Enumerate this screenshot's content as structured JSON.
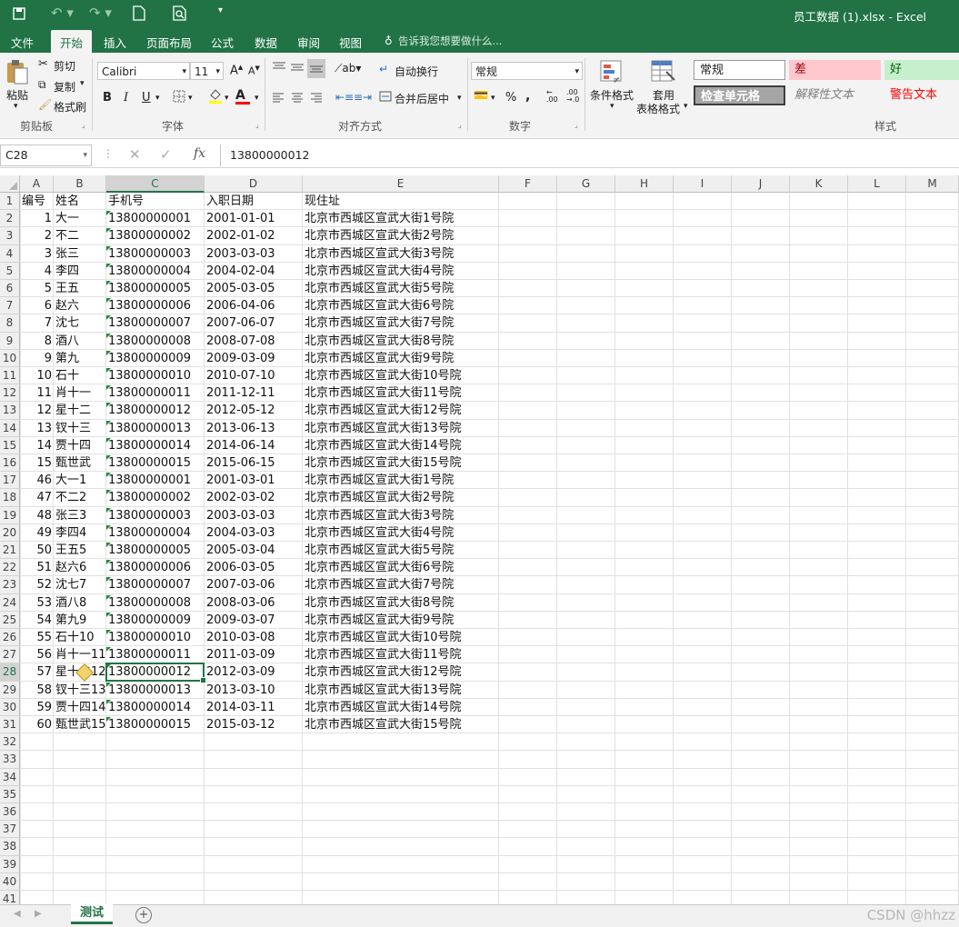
{
  "window": {
    "title": "员工数据 (1).xlsx - Excel"
  },
  "menu": {
    "items": [
      "文件",
      "开始",
      "插入",
      "页面布局",
      "公式",
      "数据",
      "审阅",
      "视图"
    ],
    "tell_me": "告诉我您想要做什么..."
  },
  "ribbon": {
    "clipboard": {
      "paste": "粘贴",
      "cut": "剪切",
      "copy": "复制",
      "format_painter": "格式刷",
      "group": "剪贴板"
    },
    "font": {
      "name": "Calibri",
      "size": "11",
      "bold": "B",
      "italic": "I",
      "underline": "U",
      "font_color_letter": "A",
      "group": "字体"
    },
    "alignment": {
      "wrap": "自动换行",
      "merge": "合并后居中",
      "group": "对齐方式"
    },
    "number": {
      "format": "常规",
      "percent": "%",
      "comma": ",",
      "group": "数字"
    },
    "styles": {
      "conditional": "条件格式",
      "table_format_1": "套用",
      "table_format_2": "表格格式",
      "normal": "常规",
      "bad": "差",
      "good": "好",
      "check_cell": "检查单元格",
      "explanatory": "解释性文本",
      "warning": "警告文本",
      "group": "样式"
    }
  },
  "formula_bar": {
    "name_box": "C28",
    "value": "13800000012"
  },
  "columns": [
    "A",
    "B",
    "C",
    "D",
    "E",
    "F",
    "G",
    "H",
    "I",
    "J",
    "K",
    "L",
    "M"
  ],
  "selected_cell": {
    "column": "C",
    "row": 28
  },
  "header_row": [
    "编号",
    "姓名",
    "手机号",
    "入职日期",
    "现住址"
  ],
  "rows": [
    [
      "1",
      "大一",
      "13800000001",
      "2001-01-01",
      "北京市西城区宣武大街1号院"
    ],
    [
      "2",
      "不二",
      "13800000002",
      "2002-01-02",
      "北京市西城区宣武大街2号院"
    ],
    [
      "3",
      "张三",
      "13800000003",
      "2003-03-03",
      "北京市西城区宣武大街3号院"
    ],
    [
      "4",
      "李四",
      "13800000004",
      "2004-02-04",
      "北京市西城区宣武大街4号院"
    ],
    [
      "5",
      "王五",
      "13800000005",
      "2005-03-05",
      "北京市西城区宣武大街5号院"
    ],
    [
      "6",
      "赵六",
      "13800000006",
      "2006-04-06",
      "北京市西城区宣武大街6号院"
    ],
    [
      "7",
      "沈七",
      "13800000007",
      "2007-06-07",
      "北京市西城区宣武大街7号院"
    ],
    [
      "8",
      "酒八",
      "13800000008",
      "2008-07-08",
      "北京市西城区宣武大街8号院"
    ],
    [
      "9",
      "第九",
      "13800000009",
      "2009-03-09",
      "北京市西城区宣武大街9号院"
    ],
    [
      "10",
      "石十",
      "13800000010",
      "2010-07-10",
      "北京市西城区宣武大街10号院"
    ],
    [
      "11",
      "肖十一",
      "13800000011",
      "2011-12-11",
      "北京市西城区宣武大街11号院"
    ],
    [
      "12",
      "星十二",
      "13800000012",
      "2012-05-12",
      "北京市西城区宣武大街12号院"
    ],
    [
      "13",
      "钗十三",
      "13800000013",
      "2013-06-13",
      "北京市西城区宣武大街13号院"
    ],
    [
      "14",
      "贾十四",
      "13800000014",
      "2014-06-14",
      "北京市西城区宣武大街14号院"
    ],
    [
      "15",
      "甄世武",
      "13800000015",
      "2015-06-15",
      "北京市西城区宣武大街15号院"
    ],
    [
      "46",
      "大一1",
      "13800000001",
      "2001-03-01",
      "北京市西城区宣武大街1号院"
    ],
    [
      "47",
      "不二2",
      "13800000002",
      "2002-03-02",
      "北京市西城区宣武大街2号院"
    ],
    [
      "48",
      "张三3",
      "13800000003",
      "2003-03-03",
      "北京市西城区宣武大街3号院"
    ],
    [
      "49",
      "李四4",
      "13800000004",
      "2004-03-03",
      "北京市西城区宣武大街4号院"
    ],
    [
      "50",
      "王五5",
      "13800000005",
      "2005-03-04",
      "北京市西城区宣武大街5号院"
    ],
    [
      "51",
      "赵六6",
      "13800000006",
      "2006-03-05",
      "北京市西城区宣武大街6号院"
    ],
    [
      "52",
      "沈七7",
      "13800000007",
      "2007-03-06",
      "北京市西城区宣武大街7号院"
    ],
    [
      "53",
      "酒八8",
      "13800000008",
      "2008-03-06",
      "北京市西城区宣武大街8号院"
    ],
    [
      "54",
      "第九9",
      "13800000009",
      "2009-03-07",
      "北京市西城区宣武大街9号院"
    ],
    [
      "55",
      "石十10",
      "13800000010",
      "2010-03-08",
      "北京市西城区宣武大街10号院"
    ],
    [
      "56",
      "肖十一11",
      "13800000011",
      "2011-03-09",
      "北京市西城区宣武大街11号院"
    ],
    [
      "57",
      "星十二12",
      "13800000012",
      "2012-03-09",
      "北京市西城区宣武大街12号院"
    ],
    [
      "58",
      "钗十三13",
      "13800000013",
      "2013-03-10",
      "北京市西城区宣武大街13号院"
    ],
    [
      "59",
      "贾十四14",
      "13800000014",
      "2014-03-11",
      "北京市西城区宣武大街14号院"
    ],
    [
      "60",
      "甄世武15",
      "13800000015",
      "2015-03-12",
      "北京市西城区宣武大街15号院"
    ]
  ],
  "total_visible_rows": 41,
  "sheet": {
    "tab": "测试",
    "add": "+"
  },
  "watermark": "CSDN @hhzz",
  "colors": {
    "accent": "#217346",
    "bad_fill": "#ffc7ce",
    "bad_text": "#9c0006",
    "good_fill": "#c6efce",
    "good_text": "#006100",
    "warning_text": "#ff0000",
    "check_fill": "#a5a5a5"
  }
}
